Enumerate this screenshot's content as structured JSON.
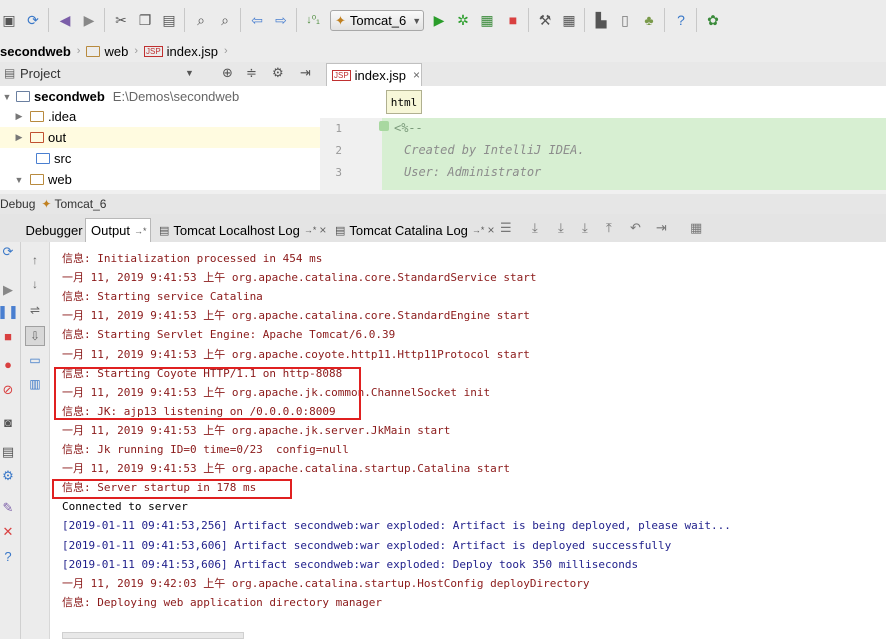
{
  "toolbar": {
    "run_config": "Tomcat_6",
    "colors": {
      "run": "#2a9d2a",
      "stop": "#d94040",
      "back": "#4a7fd0",
      "undo": "#7b5ea8"
    }
  },
  "breadcrumbs": [
    "secondweb",
    "web",
    "index.jsp"
  ],
  "project": {
    "panel_title": "Project",
    "root_name": "secondweb",
    "root_path": "E:\\Demos\\secondweb",
    "items": [
      ".idea",
      "out",
      "src",
      "web"
    ]
  },
  "editor": {
    "tab": "index.jsp",
    "tooltip": "html",
    "lines": [
      {
        "n": "1",
        "text": "<%--"
      },
      {
        "n": "2",
        "text": "Created by IntelliJ IDEA."
      },
      {
        "n": "3",
        "text": "User: Administrator"
      }
    ]
  },
  "debug": {
    "title": "Debug",
    "config": "Tomcat_6",
    "tabs": [
      "Debugger",
      "Output",
      "Tomcat Localhost Log",
      "Tomcat Catalina Log"
    ],
    "tab_suffix": "→*",
    "close": "×"
  },
  "console": [
    {
      "text": "信息: Initialization processed in 454 ms",
      "style": "red"
    },
    {
      "text": "一月 11, 2019 9:41:53 上午 org.apache.catalina.core.StandardService start",
      "style": "red"
    },
    {
      "text": "信息: Starting service Catalina",
      "style": "red"
    },
    {
      "text": "一月 11, 2019 9:41:53 上午 org.apache.catalina.core.StandardEngine start",
      "style": "red"
    },
    {
      "text": "信息: Starting Servlet Engine: Apache Tomcat/6.0.39",
      "style": "red"
    },
    {
      "text": "一月 11, 2019 9:41:53 上午 org.apache.coyote.http11.Http11Protocol start",
      "style": "red"
    },
    {
      "text": "信息: Starting Coyote HTTP/1.1 on http-8088",
      "style": "red"
    },
    {
      "text": "一月 11, 2019 9:41:53 上午 org.apache.jk.common.ChannelSocket init",
      "style": "red"
    },
    {
      "text": "信息: JK: ajp13 listening on /0.0.0.0:8009",
      "style": "red"
    },
    {
      "text": "一月 11, 2019 9:41:53 上午 org.apache.jk.server.JkMain start",
      "style": "red"
    },
    {
      "text": "信息: Jk running ID=0 time=0/23  config=null",
      "style": "red"
    },
    {
      "text": "一月 11, 2019 9:41:53 上午 org.apache.catalina.startup.Catalina start",
      "style": "red"
    },
    {
      "text": "信息: Server startup in 178 ms",
      "style": "red"
    },
    {
      "text": "Connected to server",
      "style": "blk"
    },
    {
      "text": "[2019-01-11 09:41:53,256] Artifact secondweb:war exploded: Artifact is being deployed, please wait...",
      "style": "blue"
    },
    {
      "text": "[2019-01-11 09:41:53,606] Artifact secondweb:war exploded: Artifact is deployed successfully",
      "style": "blue"
    },
    {
      "text": "[2019-01-11 09:41:53,606] Artifact secondweb:war exploded: Deploy took 350 milliseconds",
      "style": "blue"
    },
    {
      "text": "一月 11, 2019 9:42:03 上午 org.apache.catalina.startup.HostConfig deployDirectory",
      "style": "red"
    },
    {
      "text": "信息: Deploying web application directory manager",
      "style": "red"
    }
  ]
}
